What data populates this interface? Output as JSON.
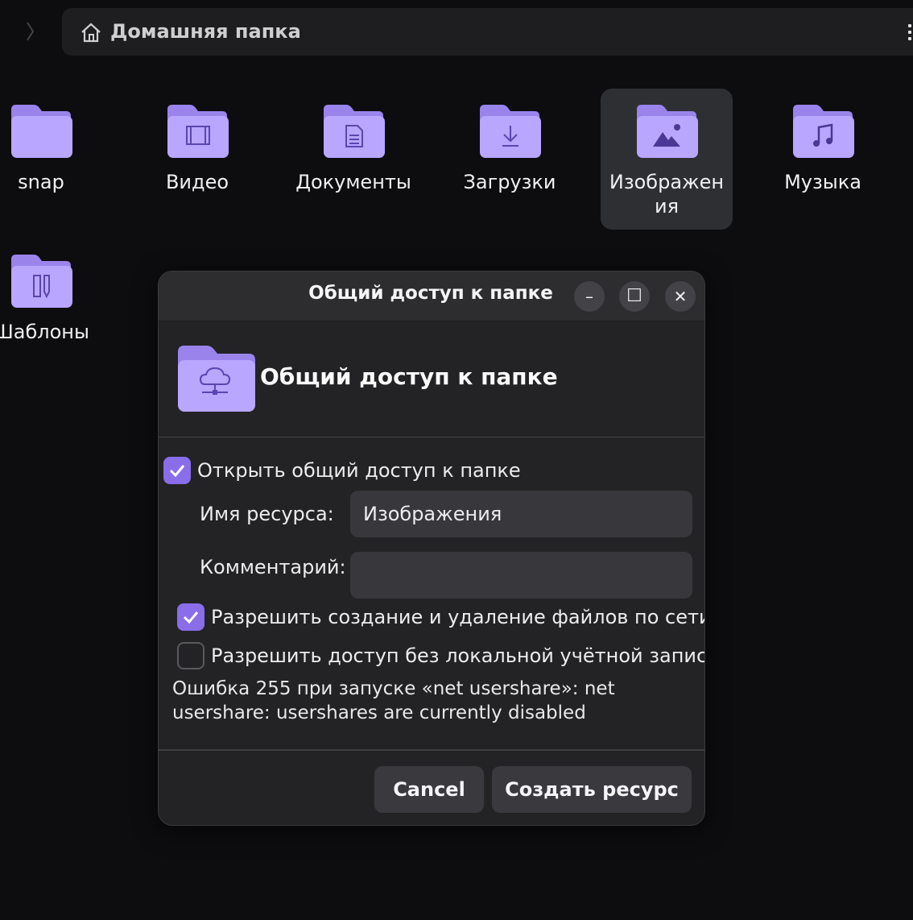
{
  "pathbar": {
    "location": "Домашняя папка"
  },
  "icons": {
    "forward": "chevron-right-icon",
    "home": "home-icon",
    "menu": "kebab-menu-icon"
  },
  "colors": {
    "folder": "#b9a6ff",
    "folder_tab": "#9a84ec",
    "accent": "#8a6de8",
    "selected_bg": "#2e2f33"
  },
  "files": [
    {
      "label": "snap",
      "icon": "folder-icon"
    },
    {
      "label": "Видео",
      "icon": "folder-videos-icon"
    },
    {
      "label": "Документы",
      "icon": "folder-documents-icon"
    },
    {
      "label": "Загрузки",
      "icon": "folder-downloads-icon"
    },
    {
      "label": "Изображения",
      "icon": "folder-pictures-icon",
      "selected": true
    },
    {
      "label": "Музыка",
      "icon": "folder-music-icon"
    },
    {
      "label": "Шаблоны",
      "icon": "folder-templates-icon"
    }
  ],
  "dialog": {
    "title": "Общий доступ к папке",
    "heading": "Общий доступ к папке",
    "share_folder_label": "Открыть общий доступ к папке",
    "share_folder_checked": true,
    "share_name_label": "Имя ресурса:",
    "share_name_value": "Изображения",
    "comment_label": "Комментарий:",
    "comment_value": "",
    "allow_write_label": "Разрешить создание и удаление файлов по сети",
    "allow_write_checked": true,
    "guest_label": "Разрешить доступ без локальной учётной записи",
    "guest_checked": false,
    "error_text": "Ошибка 255 при запуске «net usershare»: net usershare: usershares are currently disabled",
    "cancel_label": "Cancel",
    "create_label": "Создать ресурс",
    "min_glyph": "–",
    "max_glyph": "☐",
    "close_glyph": "✕"
  }
}
